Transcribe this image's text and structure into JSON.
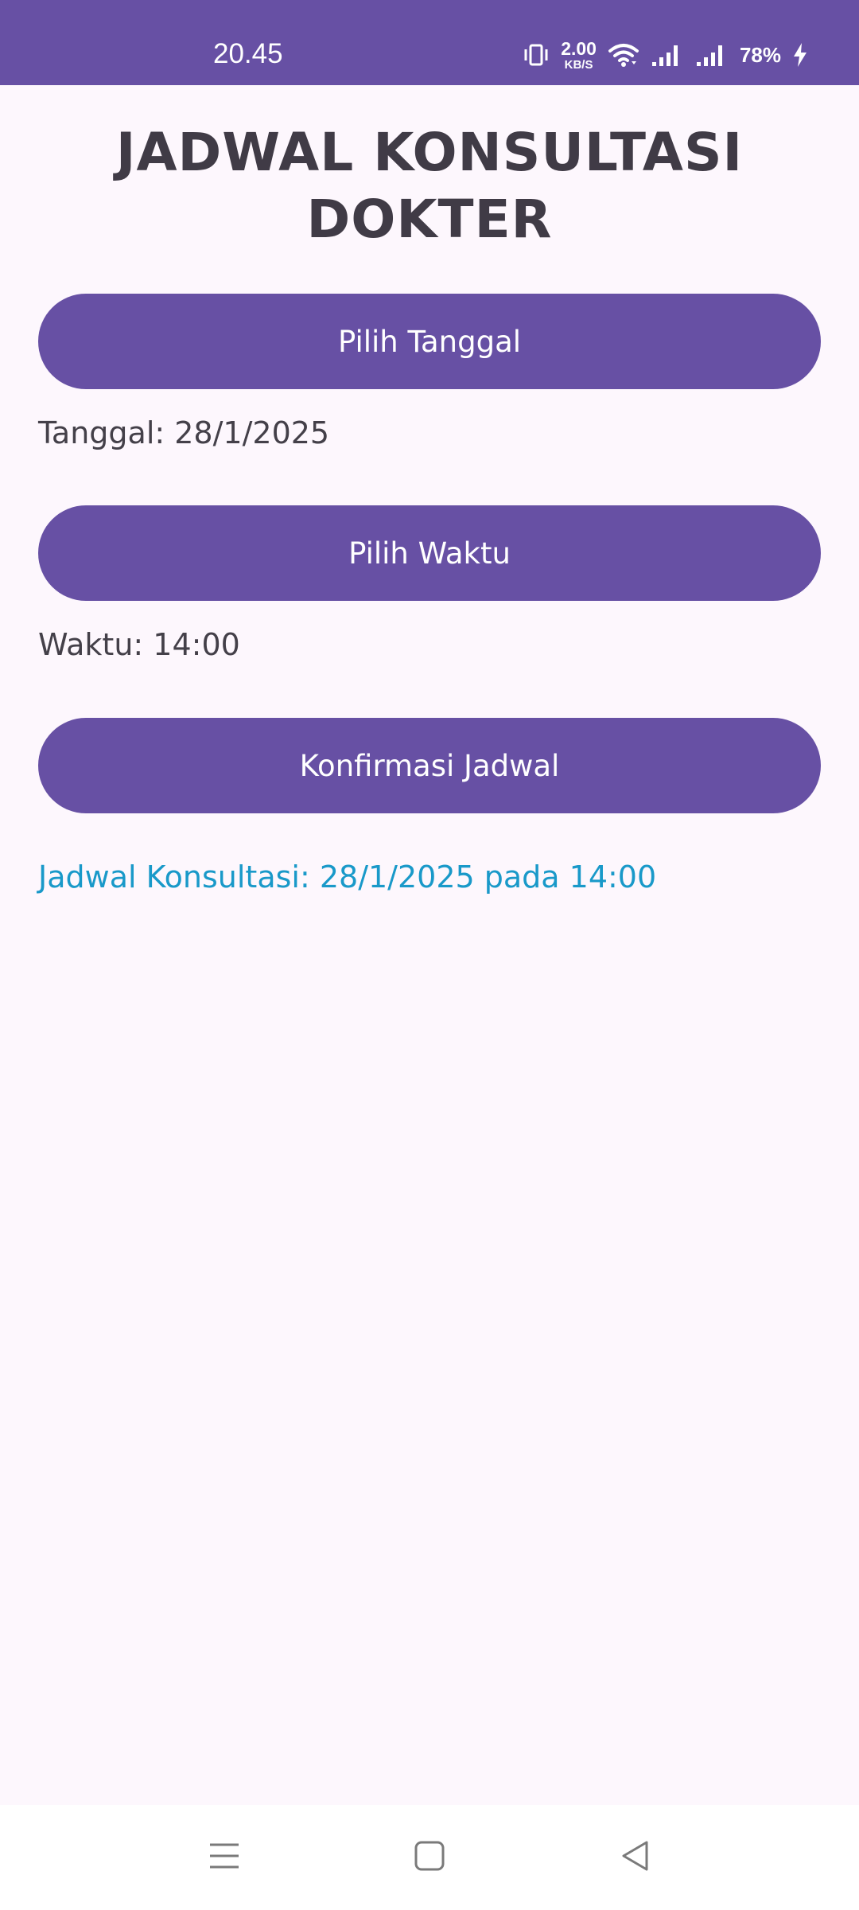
{
  "status_bar": {
    "time": "20.45",
    "network_speed": "2.00",
    "network_speed_unit": "KB/S",
    "battery": "78%",
    "icons": [
      "vibrate-icon",
      "wifi-icon",
      "signal-icon",
      "signal-icon",
      "charging-icon"
    ],
    "background_color": "#6750a4"
  },
  "page": {
    "title_line1": "JADWAL KONSULTASI",
    "title_line2": "DOKTER"
  },
  "buttons": {
    "pick_date": "Pilih Tanggal",
    "pick_time": "Pilih Waktu",
    "confirm": "Konfirmasi Jadwal",
    "color": "#6750a4"
  },
  "info": {
    "date": "Tanggal: 28/1/2025",
    "time": "Waktu: 14:00",
    "result": "Jadwal Konsultasi: 28/1/2025 pada 14:00",
    "result_color": "#1999c9"
  },
  "nav_bar": {
    "icons": [
      "menu-icon",
      "home-icon",
      "back-icon"
    ]
  }
}
